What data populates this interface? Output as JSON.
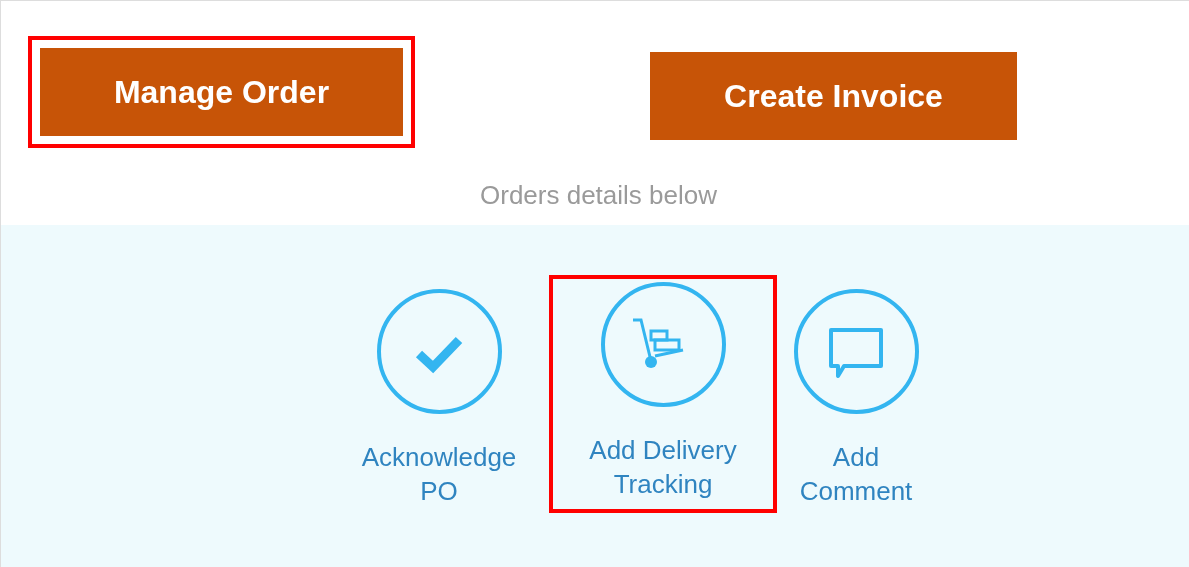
{
  "buttons": [
    {
      "label": "Manage Order",
      "highlighted": true
    },
    {
      "label": "Create Invoice",
      "highlighted": false
    }
  ],
  "caption": "Orders details below",
  "actions": [
    {
      "kind": "check",
      "label": "Acknowledge PO",
      "highlighted": false
    },
    {
      "kind": "cart",
      "label": "Add Delivery Tracking",
      "highlighted": true
    },
    {
      "kind": "comment",
      "label": "Add Comment",
      "highlighted": false
    }
  ]
}
